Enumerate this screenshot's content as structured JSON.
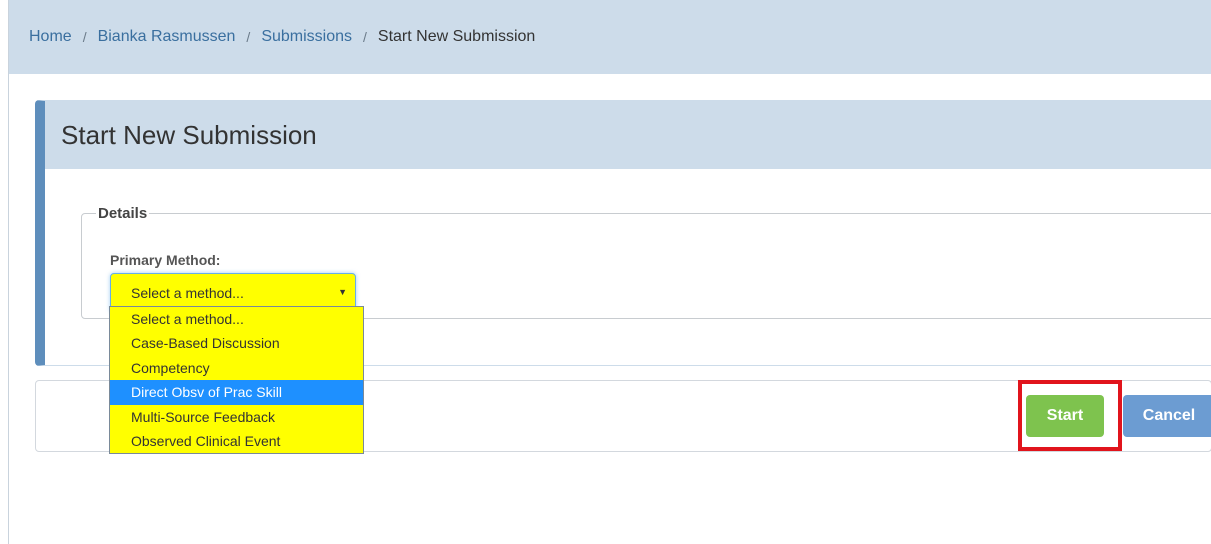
{
  "breadcrumb": {
    "items": [
      "Home",
      "Bianka Rasmussen",
      "Submissions"
    ],
    "separator": "/",
    "current": "Start New Submission"
  },
  "panel": {
    "title": "Start New Submission"
  },
  "details": {
    "legend": "Details",
    "primary_method_label": "Primary Method:",
    "select_value": "Select a method..."
  },
  "dropdown": {
    "options": [
      "Select a method...",
      "Case-Based Discussion",
      "Competency",
      "Direct Obsv of Prac Skill",
      "Multi-Source Feedback",
      "Observed Clinical Event"
    ],
    "highlighted_option": "Direct Obsv of Prac Skill"
  },
  "actions": {
    "start_label": "Start",
    "cancel_label": "Cancel"
  },
  "colors": {
    "header_bg": "#cddcea",
    "panel_accent": "#5e8ebc",
    "select_bg": "#ffff00",
    "option_highlight": "#1e90ff",
    "start_button": "#7ec34e",
    "cancel_button": "#6c9cd2",
    "annotation_box": "#e1141c"
  }
}
